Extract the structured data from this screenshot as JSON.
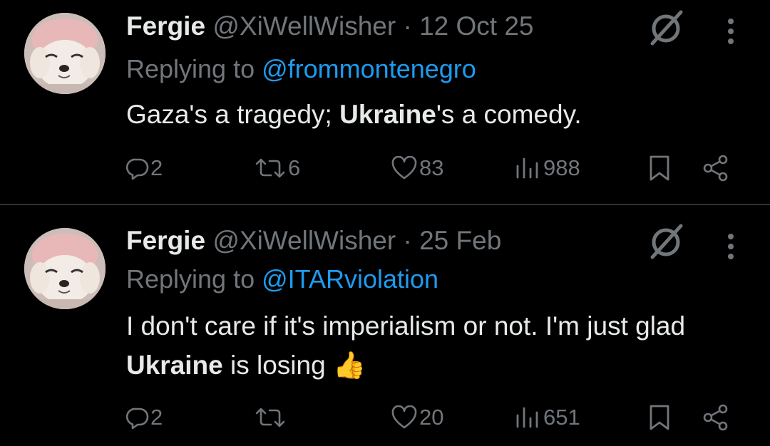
{
  "tweets": [
    {
      "display_name": "Fergie",
      "handle": "@XiWellWisher",
      "separator": "·",
      "date": "12 Oct 25",
      "replying_prefix": "Replying to",
      "replying_handle": "@frommontenegro",
      "body": [
        {
          "text": "Gaza's a tragedy; ",
          "bold": false
        },
        {
          "text": "Ukraine",
          "bold": true
        },
        {
          "text": "'s a comedy.",
          "bold": false
        }
      ],
      "replies": "2",
      "reposts": "6",
      "likes": "83",
      "views": "988"
    },
    {
      "display_name": "Fergie",
      "handle": "@XiWellWisher",
      "separator": "·",
      "date": "25 Feb",
      "replying_prefix": "Replying to",
      "replying_handle": "@ITARviolation",
      "body": [
        {
          "text": "I don't care if it's imperialism or not. I'm just glad ",
          "bold": false
        },
        {
          "text": "Ukraine",
          "bold": true
        },
        {
          "text": " is losing ",
          "bold": false
        },
        {
          "text": "👍",
          "bold": false
        }
      ],
      "replies": "2",
      "reposts": "",
      "likes": "20",
      "views": "651"
    }
  ],
  "colors": {
    "background": "#000000",
    "text": "#e7e9ea",
    "muted": "#71767b",
    "link": "#1d9bf0",
    "divider": "#2f3336"
  },
  "icons": [
    "avatar-image",
    "grok-icon",
    "more-icon",
    "reply-icon",
    "repost-icon",
    "like-icon",
    "views-icon",
    "bookmark-icon",
    "share-icon"
  ]
}
